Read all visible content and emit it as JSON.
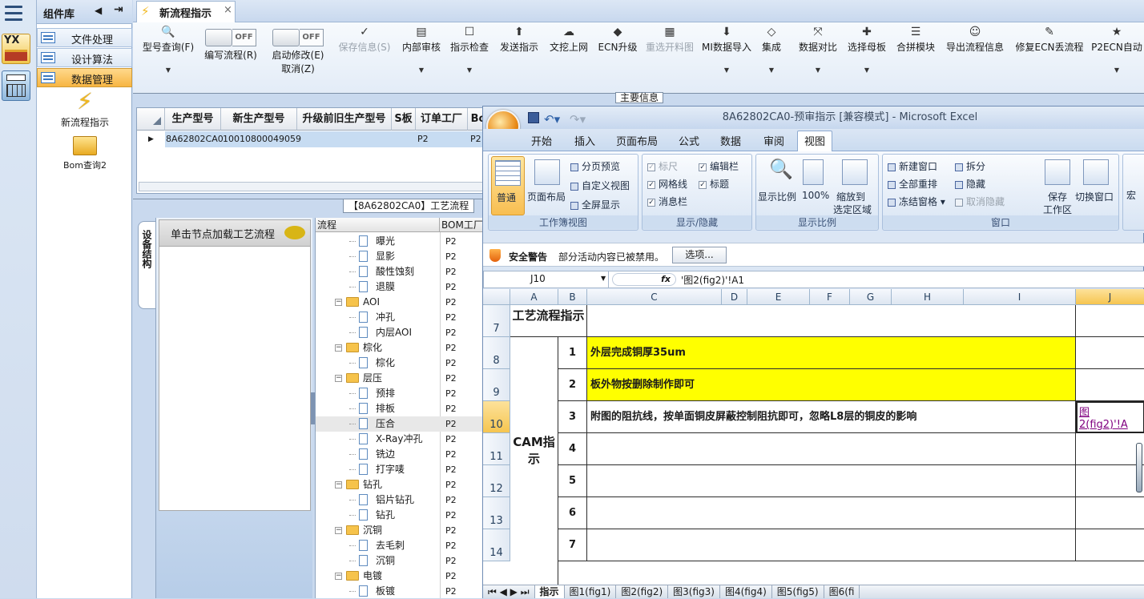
{
  "sidebar": {
    "logo_text": "YX"
  },
  "library": {
    "title": "组件库",
    "items": [
      {
        "label": "文件处理",
        "active": false
      },
      {
        "label": "设计算法",
        "active": false
      },
      {
        "label": "数据管理",
        "active": true
      }
    ],
    "tools": [
      {
        "label": "新流程指示",
        "icon": "lightning-icon"
      },
      {
        "label": "Bom查询2",
        "icon": "folder-open-icon"
      }
    ]
  },
  "tab": {
    "title": "新流程指示",
    "close": "×"
  },
  "toolbar": {
    "model_query": "型号查询(F)",
    "edit_flow": "编写流程(R)",
    "start_modify": "启动修改(E)",
    "cancel": "取消(Z)",
    "toggle_off": "OFF",
    "save_info": "保存信息(S)",
    "buttons": [
      "内部审核",
      "指示检查",
      "发送指示",
      "文挖上网",
      "ECN升级",
      "重选开料图",
      "MI数据导入",
      "集成",
      "数据对比",
      "选择母板",
      "合拼模块",
      "导出流程信息",
      "修复ECN丢流程",
      "P2ECN自动"
    ]
  },
  "main_info_label": "主要信息",
  "grid": {
    "columns": [
      "生产型号",
      "新生产型号",
      "升级前旧生产型号",
      "S板",
      "订单工厂",
      "Bo"
    ],
    "row": [
      "8A62802CA0",
      "10010800049059",
      "",
      "",
      "P2",
      "P2"
    ]
  },
  "process_label": "【8A62802CA0】工艺流程",
  "side_tab": "设备结构",
  "click_hint": "单击节点加载工艺流程",
  "tree": {
    "headers": [
      "流程",
      "BOM工厂"
    ],
    "nodes": [
      {
        "label": "曝光",
        "level": 2,
        "bom": "P2"
      },
      {
        "label": "显影",
        "level": 2,
        "bom": "P2"
      },
      {
        "label": "酸性蚀刻",
        "level": 2,
        "bom": "P2"
      },
      {
        "label": "退膜",
        "level": 2,
        "bom": "P2"
      },
      {
        "label": "AOI",
        "level": 1,
        "bom": "P2"
      },
      {
        "label": "冲孔",
        "level": 2,
        "bom": "P2"
      },
      {
        "label": "内层AOI",
        "level": 2,
        "bom": "P2"
      },
      {
        "label": "棕化",
        "level": 1,
        "bom": "P2"
      },
      {
        "label": "棕化",
        "level": 2,
        "bom": "P2"
      },
      {
        "label": "层压",
        "level": 1,
        "bom": "P2"
      },
      {
        "label": "预排",
        "level": 2,
        "bom": "P2"
      },
      {
        "label": "排板",
        "level": 2,
        "bom": "P2"
      },
      {
        "label": "压合",
        "level": 2,
        "bom": "P2"
      },
      {
        "label": "X-Ray冲孔",
        "level": 2,
        "bom": "P2"
      },
      {
        "label": "铣边",
        "level": 2,
        "bom": "P2"
      },
      {
        "label": "打字唛",
        "level": 2,
        "bom": "P2"
      },
      {
        "label": "钻孔",
        "level": 1,
        "bom": "P2"
      },
      {
        "label": "铝片钻孔",
        "level": 2,
        "bom": "P2"
      },
      {
        "label": "钻孔",
        "level": 2,
        "bom": "P2"
      },
      {
        "label": "沉铜",
        "level": 1,
        "bom": "P2"
      },
      {
        "label": "去毛刺",
        "level": 2,
        "bom": "P2"
      },
      {
        "label": "沉铜",
        "level": 2,
        "bom": "P2"
      },
      {
        "label": "电镀",
        "level": 1,
        "bom": "P2"
      },
      {
        "label": "板镀",
        "level": 2,
        "bom": "P2"
      }
    ]
  },
  "excel": {
    "title": "8A62802CA0-预审指示 [兼容模式] - Microsoft Excel",
    "tabs": [
      "开始",
      "插入",
      "页面布局",
      "公式",
      "数据",
      "审阅",
      "视图"
    ],
    "selected_tab": "视图",
    "views": {
      "normal": "普通",
      "page_layout": "页面布局",
      "page_break": "分页预览",
      "custom": "自定义视图",
      "full": "全屏显示",
      "group": "工作簿视图"
    },
    "show": {
      "ruler": "标尺",
      "formula_bar": "编辑栏",
      "gridlines": "网格线",
      "headings": "标题",
      "message_bar": "消息栏",
      "group": "显示/隐藏"
    },
    "zoom": {
      "zoom": "显示比例",
      "p100": "100%",
      "zoom_sel_1": "缩放到",
      "zoom_sel_2": "选定区域",
      "group": "显示比例"
    },
    "window": {
      "new": "新建窗口",
      "arrange": "全部重排",
      "freeze": "冻结窗格",
      "split": "拆分",
      "hide": "隐藏",
      "unhide": "取消隐藏",
      "save_1": "保存",
      "save_2": "工作区",
      "switch": "切换窗口",
      "group": "窗口",
      "macro": "宏"
    },
    "security": {
      "label": "安全警告",
      "message": "部分活动内容已被禁用。",
      "button": "选项..."
    },
    "name_box": "J10",
    "formula": "'图2(fig2)'!A1",
    "col_headers": [
      "A",
      "B",
      "C",
      "D",
      "E",
      "F",
      "G",
      "H",
      "I",
      "J"
    ],
    "rows": [
      {
        "num": "7",
        "label": "工艺流程指示"
      },
      {
        "num": "8",
        "idx": "1",
        "text": "外层完成铜厚35um"
      },
      {
        "num": "9",
        "idx": "2",
        "text": "板外物按删除制作即可"
      },
      {
        "num": "10",
        "idx": "3",
        "text": "附图的阻抗线，按单面铜皮屏蔽控制阻抗即可，忽略L8层的铜皮的影响",
        "link1": "图",
        "link2": "2(fig2)'!A"
      },
      {
        "num": "11",
        "idx": "4"
      },
      {
        "num": "12",
        "idx": "5"
      },
      {
        "num": "13",
        "idx": "6"
      },
      {
        "num": "14",
        "idx": "7"
      }
    ],
    "cam_label": "CAM指示",
    "sheets": [
      "指示",
      "图1(fig1)",
      "图2(fig2)",
      "图3(fig3)",
      "图4(fig4)",
      "图5(fig5)",
      "图6(fi"
    ]
  }
}
